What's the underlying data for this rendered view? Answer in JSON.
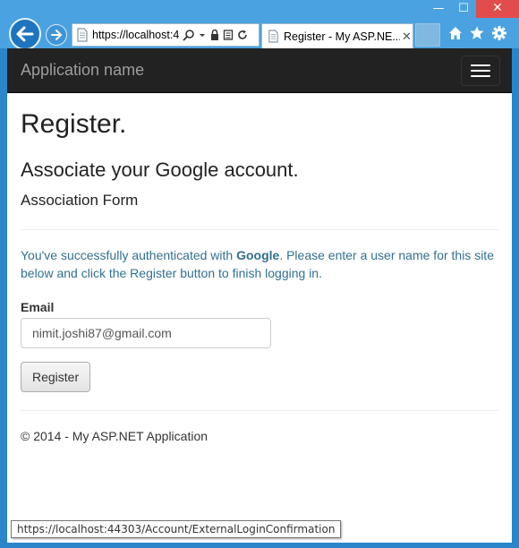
{
  "browser": {
    "url": "https://localhost:4",
    "tab_title": "Register - My ASP.NE...",
    "tab_close": "✕",
    "window_controls": {
      "minimize": "—",
      "maximize": "☐",
      "close": "✕"
    },
    "icons": [
      "back-icon",
      "forward-icon",
      "search-icon",
      "dropdown-icon",
      "lock-icon",
      "compat-icon",
      "refresh-icon",
      "home-icon",
      "favorites-star-icon",
      "settings-gear-icon"
    ]
  },
  "navbar": {
    "brand": "Application name"
  },
  "main": {
    "title": "Register.",
    "subtitle": "Associate your Google account.",
    "form_heading": "Association Form",
    "info_prefix": "You've successfully authenticated with ",
    "info_provider": "Google",
    "info_suffix": ". Please enter a user name for this site below and click the Register button to finish logging in.",
    "email_label": "Email",
    "email_value": "nimit.joshi87@gmail.com",
    "register_label": "Register"
  },
  "footer": {
    "text": "© 2014 - My ASP.NET Application"
  },
  "status": {
    "link_url": "https://localhost:44303/Account/ExternalLoginConfirmation"
  },
  "colors": {
    "navbar_bg": "#222222",
    "info_text": "#31708f",
    "chrome_blue": "#4aa3e0",
    "close_red": "#e24c4c"
  }
}
